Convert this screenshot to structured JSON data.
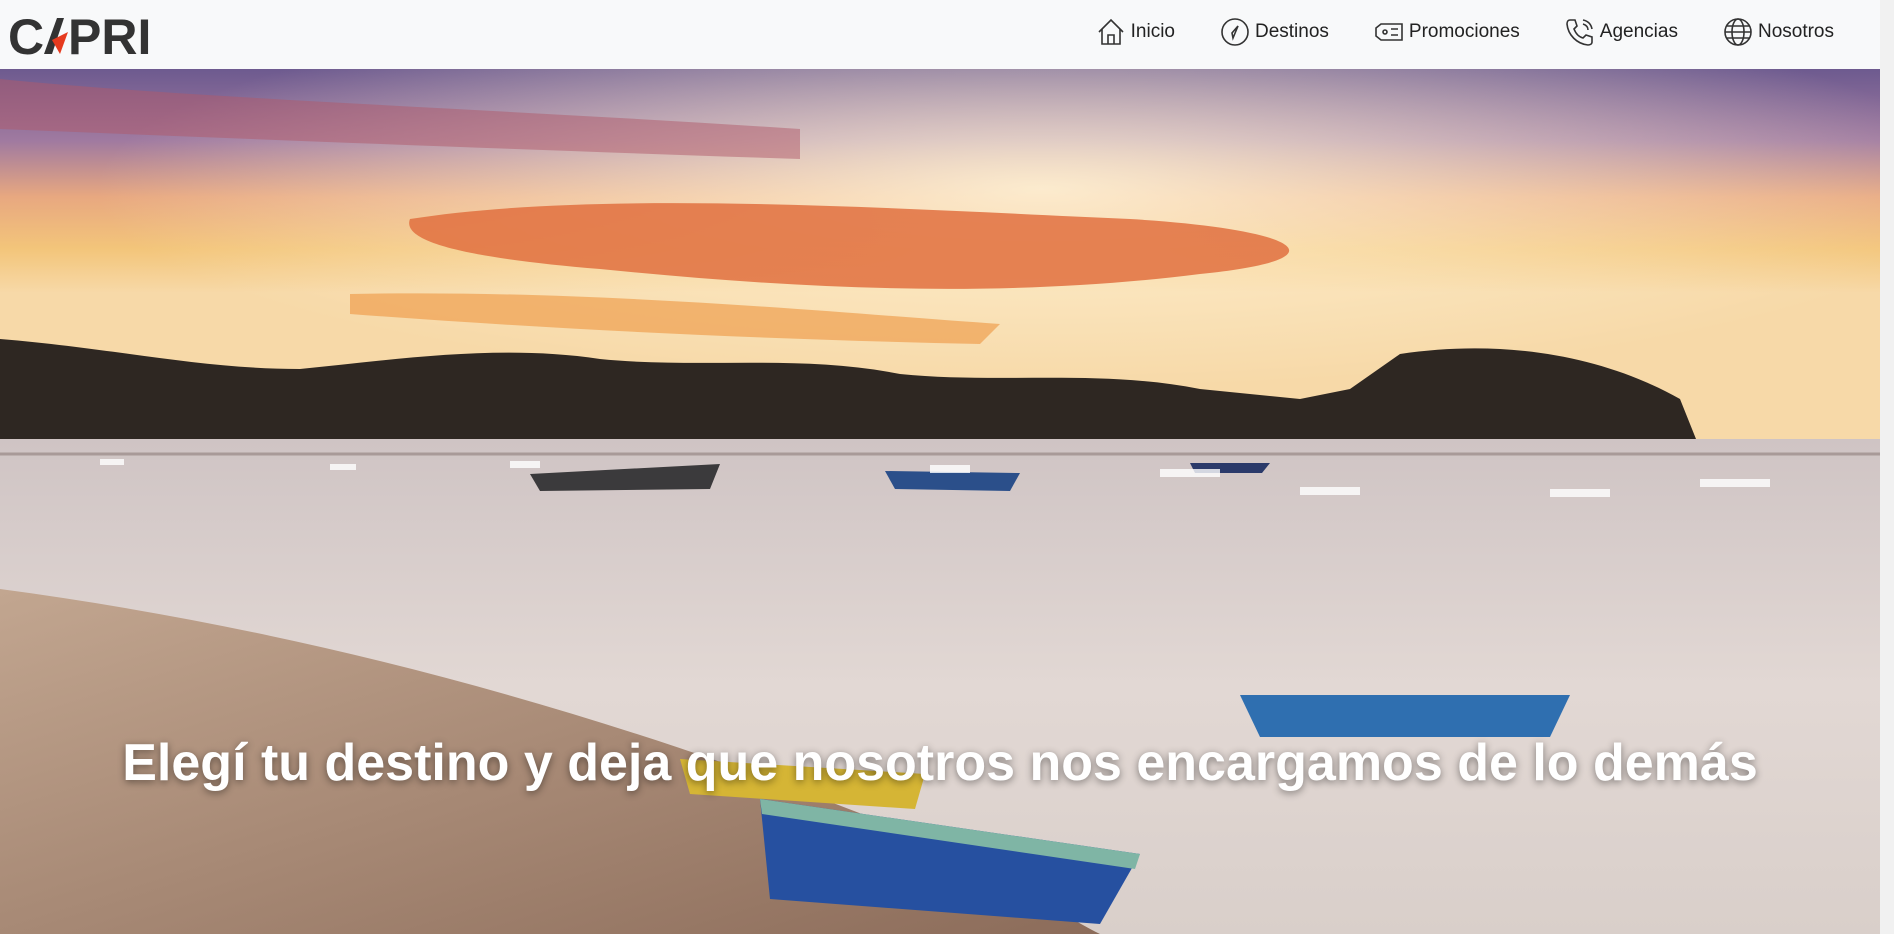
{
  "brand": {
    "logo_text": "CAPRI"
  },
  "nav": {
    "items": [
      {
        "label": "Inicio",
        "icon": "home-icon"
      },
      {
        "label": "Destinos",
        "icon": "compass-icon"
      },
      {
        "label": "Promociones",
        "icon": "ticket-icon"
      },
      {
        "label": "Agencias",
        "icon": "phone-icon"
      },
      {
        "label": "Nosotros",
        "icon": "globe-icon"
      }
    ]
  },
  "hero": {
    "headline": "Elegí tu destino y deja que nosotros nos encargamos de lo demás",
    "image": "sunset-beach-boats-image"
  },
  "colors": {
    "navbar_bg": "#f8f9fa",
    "logo_dark": "#333333",
    "logo_accent": "#e63a1e",
    "headline": "#ffffff"
  }
}
